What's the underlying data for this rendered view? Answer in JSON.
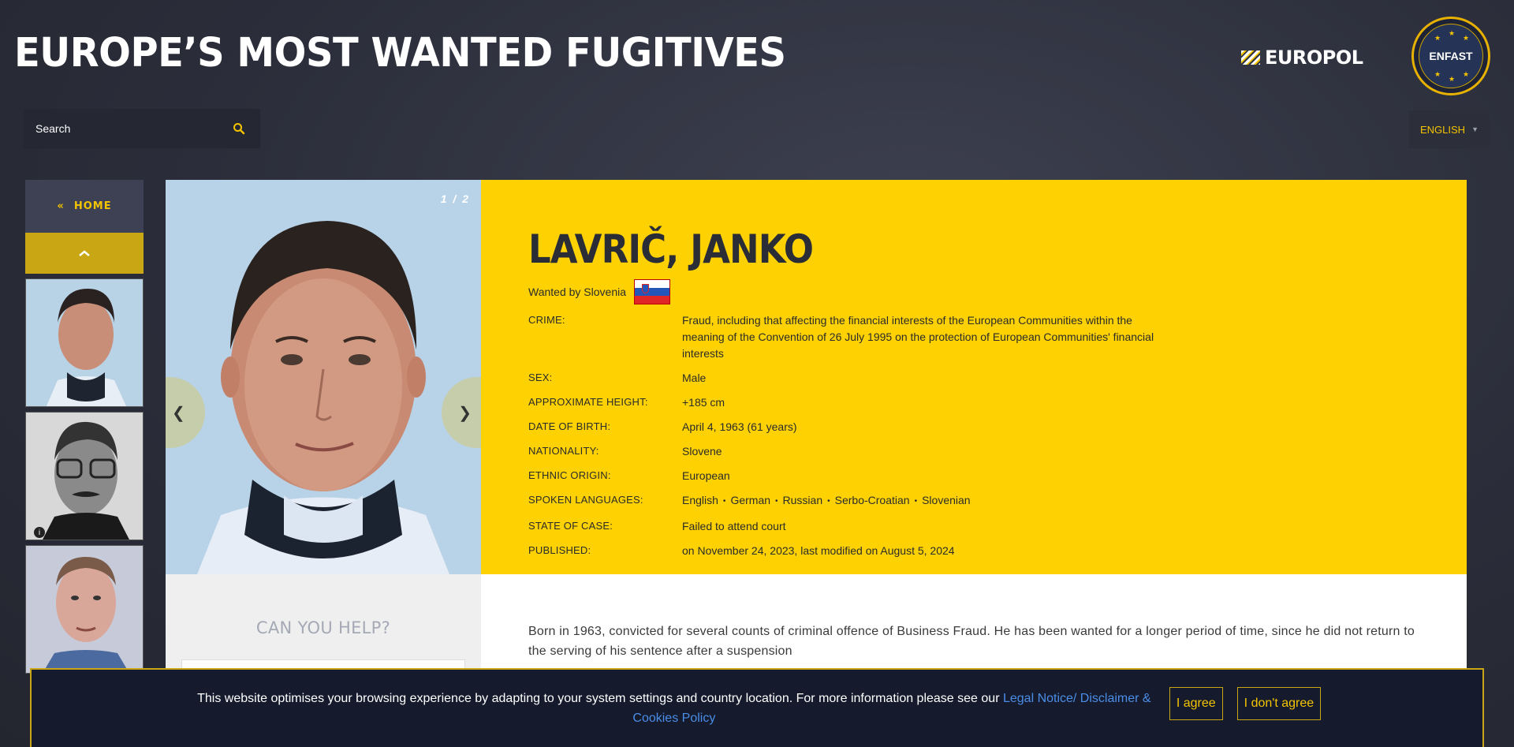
{
  "header": {
    "title": "EUROPE’S MOST WANTED FUGITIVES",
    "europol_logo_text": "EUROPOL",
    "enfast_badge_text": "ENFAST"
  },
  "search": {
    "placeholder": "Search",
    "value": ""
  },
  "language": {
    "selected": "ENGLISH"
  },
  "sidebar": {
    "home_label": "HOME"
  },
  "photo": {
    "counter": "1 / 2"
  },
  "fugitive": {
    "name": "LAVRIČ, JANKO",
    "wanted_by": "Wanted by Slovenia",
    "facts": [
      {
        "label": "CRIME:",
        "value": "Fraud, including that affecting the financial interests of the European Communities within the meaning of the Convention of 26 July 1995 on the protection of European Communities' financial interests"
      },
      {
        "label": "SEX:",
        "value": "Male"
      },
      {
        "label": "APPROXIMATE HEIGHT:",
        "value": "+185 cm"
      },
      {
        "label": "DATE OF BIRTH:",
        "value": "April 4, 1963 (61 years)"
      },
      {
        "label": "NATIONALITY:",
        "value": "Slovene"
      },
      {
        "label": "ETHNIC ORIGIN:",
        "value": "European"
      },
      {
        "label": "SPOKEN LANGUAGES:",
        "languages": [
          "English",
          "German",
          "Russian",
          "Serbo-Croatian",
          "Slovenian"
        ]
      },
      {
        "label": "STATE OF CASE:",
        "value": "Failed to attend court"
      },
      {
        "label": "PUBLISHED:",
        "value": "on November 24, 2023, last modified on August 5, 2024"
      }
    ],
    "description": "Born in 1963, convicted for several counts of criminal offence of Business Fraud. He has been wanted for a longer period of time, since he did not return to the serving of his sentence after a suspension"
  },
  "help": {
    "title": "CAN YOU HELP?"
  },
  "cookie": {
    "text": "This website optimises your browsing experience by adapting to your system settings and country location. For more information please see our ",
    "link_text": "Legal Notice/ Disclaimer & Cookies Policy",
    "agree_label": "I agree",
    "disagree_label": "I don't agree"
  },
  "colors": {
    "accent_yellow": "#fed202",
    "button_gold": "#c8a614",
    "background_dark": "#2b2d3a",
    "link_blue": "#4a8de8"
  }
}
